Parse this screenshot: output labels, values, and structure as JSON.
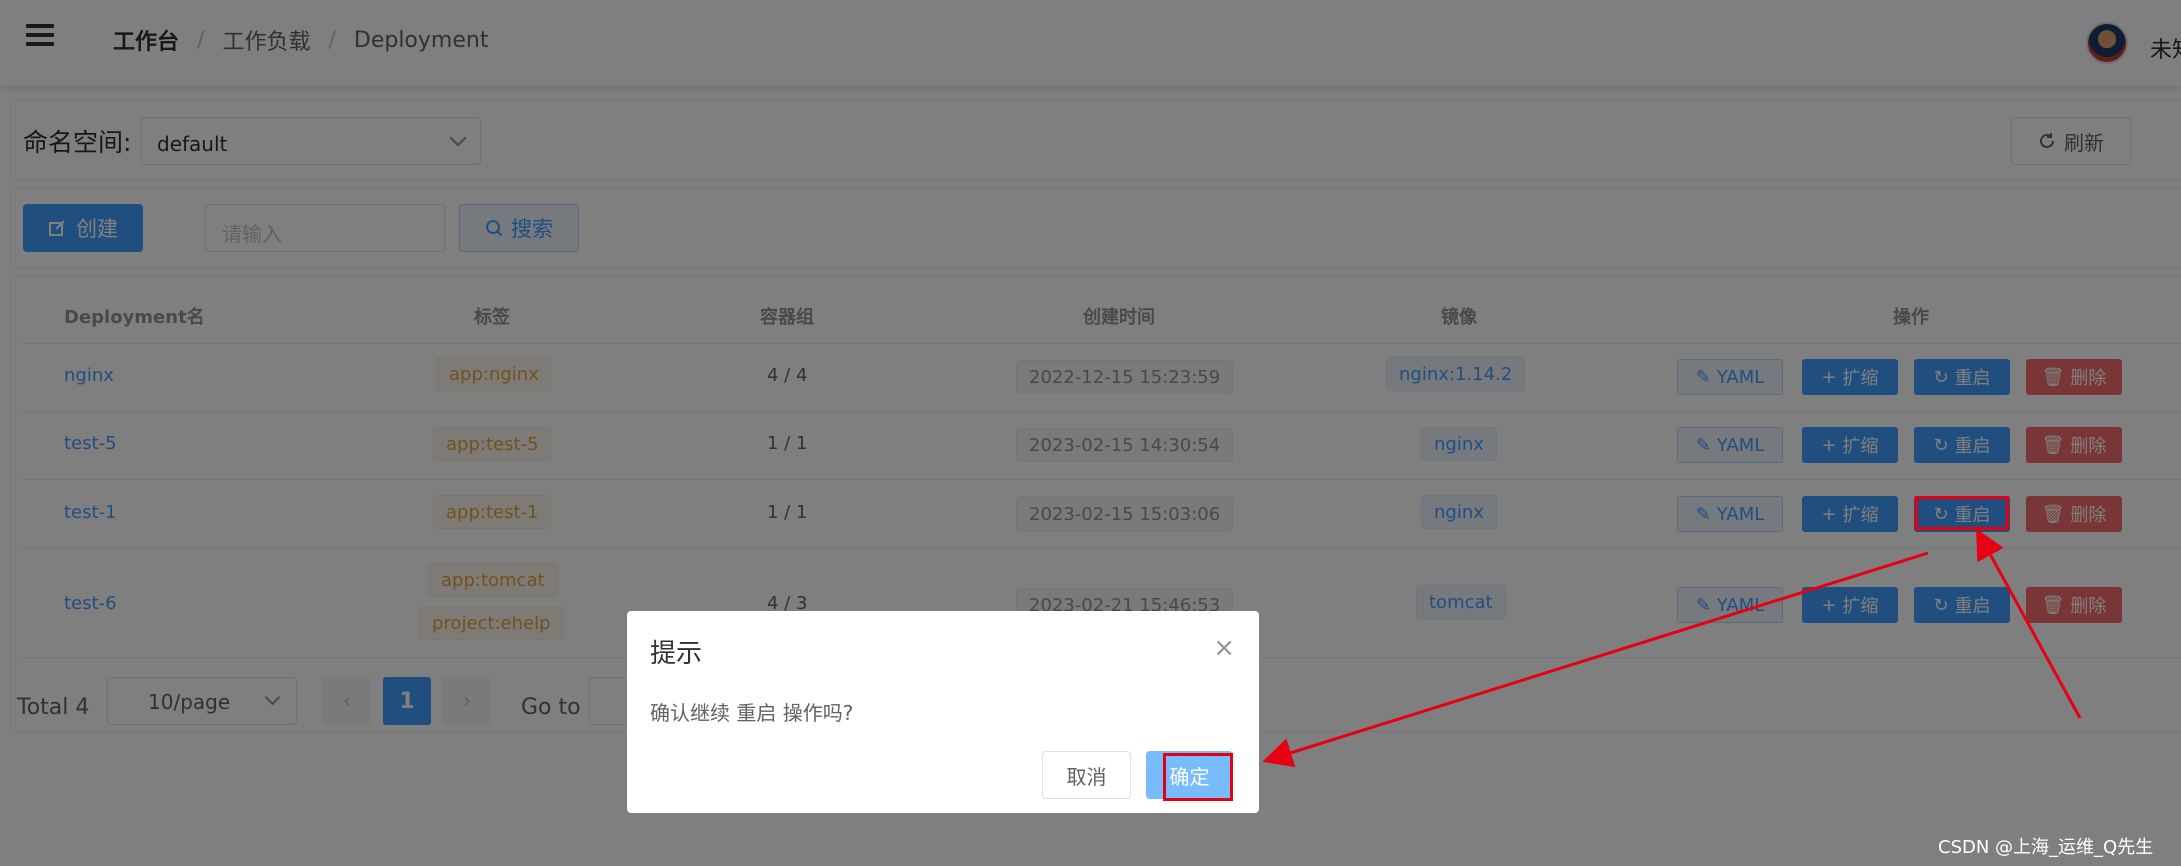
{
  "header": {
    "breadcrumb": [
      "工作台",
      "工作负载",
      "Deployment"
    ],
    "username": "未知"
  },
  "namespace": {
    "label": "命名空间:",
    "value": "default",
    "refresh_label": "刷新"
  },
  "toolbar": {
    "create_label": "创建",
    "search_placeholder": "请输入",
    "search_label": "搜索"
  },
  "table": {
    "columns": [
      "Deployment名",
      "标签",
      "容器组",
      "创建时间",
      "镜像",
      "操作"
    ],
    "rows": [
      {
        "name": "nginx",
        "labels": [
          "app:nginx"
        ],
        "pods": "4 / 4",
        "created": "2022-12-15 15:23:59",
        "image": "nginx:1.14.2"
      },
      {
        "name": "test-5",
        "labels": [
          "app:test-5"
        ],
        "pods": "1 / 1",
        "created": "2023-02-15 14:30:54",
        "image": "nginx"
      },
      {
        "name": "test-1",
        "labels": [
          "app:test-1"
        ],
        "pods": "1 / 1",
        "created": "2023-02-15 15:03:06",
        "image": "nginx"
      },
      {
        "name": "test-6",
        "labels": [
          "app:tomcat",
          "project:ehelp"
        ],
        "pods": "4 / 3",
        "created": "2023-02-21 15:46:53",
        "image": "tomcat"
      }
    ],
    "actions": {
      "yaml": "YAML",
      "scale": "扩缩",
      "restart": "重启",
      "delete": "删除"
    }
  },
  "pagination": {
    "total": "Total 4",
    "page_size": "10/page",
    "prev": "‹",
    "page": "1",
    "next": "›",
    "goto": "Go to"
  },
  "dialog": {
    "title": "提示",
    "close": "×",
    "message": "确认继续 重启 操作吗?",
    "cancel": "取消",
    "confirm": "确定"
  },
  "watermark": "CSDN @上海_运维_Q先生",
  "colors": {
    "primary": "#409eff",
    "danger": "#f56c6c",
    "warning": "#e6a23c",
    "annotation": "#e60012"
  }
}
